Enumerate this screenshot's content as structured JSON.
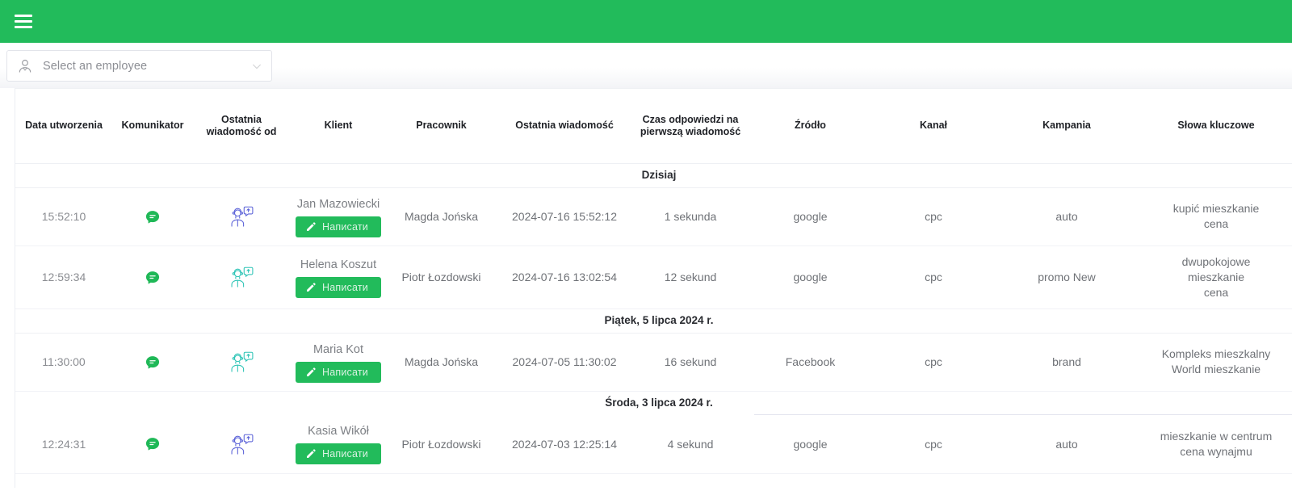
{
  "topbar": {
    "menu_icon": "hamburger-menu-icon",
    "background": "#22bb5b"
  },
  "filter": {
    "icon": "employee-avatar-icon",
    "placeholder": "Select an employee",
    "value": "",
    "chevron_icon": "chevron-down-icon"
  },
  "table": {
    "columns": [
      "Data utworzenia",
      "Komunikator",
      "Ostatnia wiadomość od",
      "Klient",
      "Pracownik",
      "Ostatnia wiadomość",
      "Czas odpowiedzi na pierwszą wiadomość",
      "Źródło",
      "Kanał",
      "Kampania",
      "Słowa kluczowe"
    ],
    "write_button_label": "Написати",
    "groups": [
      {
        "label": "Dzisiaj",
        "partial_border": false,
        "rows": [
          {
            "time": "15:52:10",
            "messenger_icon": "chat-bubble-icon",
            "last_message_from_icon": "support-agent-icon",
            "last_message_from_color": "#5c63d8",
            "client": "Jan Mazowiecki",
            "employee": "Magda Jońska",
            "last_message": "2024-07-16 15:52:12",
            "response_time": "1 sekunda",
            "source": "google",
            "channel": "cpc",
            "campaign": "auto",
            "keywords": "kupić mieszkanie\ncena"
          },
          {
            "time": "12:59:34",
            "messenger_icon": "chat-bubble-icon",
            "last_message_from_icon": "support-agent-icon",
            "last_message_from_color": "#2ec4b6",
            "client": "Helena Koszut",
            "employee": "Piotr Łozdowski",
            "last_message": "2024-07-16 13:02:54",
            "response_time": "12 sekund",
            "source": "google",
            "channel": "cpc",
            "campaign": "promo New",
            "keywords": "dwupokojowe\nmieszkanie\ncena"
          }
        ]
      },
      {
        "label": "Piątek, 5 lipca 2024 r.",
        "partial_border": false,
        "rows": [
          {
            "time": "11:30:00",
            "messenger_icon": "chat-bubble-icon",
            "last_message_from_icon": "support-agent-icon",
            "last_message_from_color": "#2ec4b6",
            "client": "Maria Kot",
            "employee": "Magda Jońska",
            "last_message": "2024-07-05 11:30:02",
            "response_time": "16 sekund",
            "source": "Facebook",
            "channel": "cpc",
            "campaign": "brand",
            "keywords": "Kompleks mieszkalny\nWorld mieszkanie"
          }
        ]
      },
      {
        "label": "Środa, 3 lipca 2024 r.",
        "partial_border": true,
        "rows": [
          {
            "time": "12:24:31",
            "messenger_icon": "chat-bubble-icon",
            "last_message_from_icon": "support-agent-icon",
            "last_message_from_color": "#5c63d8",
            "client": "Kasia Wikół",
            "employee": "Piotr Łozdowski",
            "last_message": "2024-07-03 12:25:14",
            "response_time": "4 sekund",
            "source": "google",
            "channel": "cpc",
            "campaign": "auto",
            "keywords": "mieszkanie w centrum\ncena wynajmu"
          }
        ]
      }
    ]
  },
  "colors": {
    "brand_green": "#22bb5b",
    "bubble_green": "#1fb857",
    "agent_blue": "#5c63d8",
    "agent_teal": "#2ec4b6"
  }
}
